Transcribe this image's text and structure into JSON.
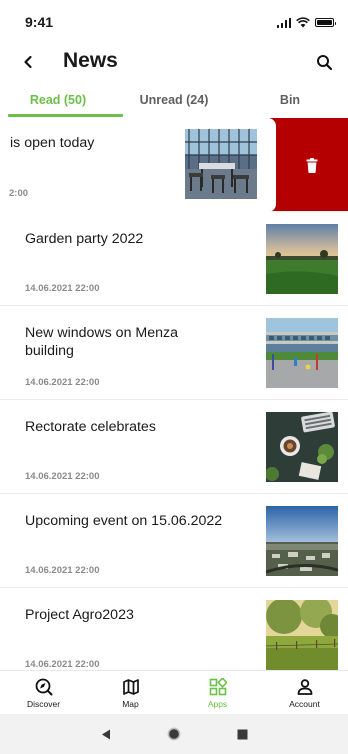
{
  "status_bar": {
    "time": "9:41"
  },
  "header": {
    "title": "News",
    "back_icon": "chevron-left-icon",
    "search_icon": "search-icon"
  },
  "tabs": [
    {
      "label": "Read (50)",
      "active": true
    },
    {
      "label": "Unread (24)",
      "active": false
    },
    {
      "label": "Bin",
      "active": false
    }
  ],
  "swiped_item": {
    "title": "is open today",
    "date": "2:00",
    "action_icon": "trash-icon"
  },
  "news": [
    {
      "title": "Garden party 2022",
      "date": "14.06.2021 22:00"
    },
    {
      "title": "New windows on Menza building",
      "date": "14.06.2021 22:00"
    },
    {
      "title": "Rectorate celebrates",
      "date": "14.06.2021 22:00"
    },
    {
      "title": "Upcoming event on 15.06.2022",
      "date": "14.06.2021 22:00"
    },
    {
      "title": "Project Agro2023",
      "date": "14.06.2021 22:00"
    }
  ],
  "bottom_nav": [
    {
      "label": "Discover",
      "icon": "discover-icon",
      "active": false
    },
    {
      "label": "Map",
      "icon": "map-icon",
      "active": false
    },
    {
      "label": "Apps",
      "icon": "apps-icon",
      "active": true
    },
    {
      "label": "Account",
      "icon": "account-icon",
      "active": false
    }
  ],
  "colors": {
    "accent": "#6cc04a",
    "delete": "#b40000"
  }
}
